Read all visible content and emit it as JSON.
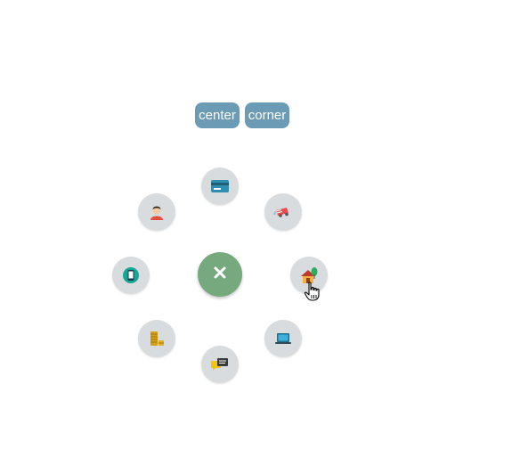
{
  "modes": {
    "center_label": "center",
    "corner_label": "corner"
  },
  "colors": {
    "mode_button": "#6c9bb6",
    "hub": "#76a97e",
    "item_bg": "#d9dcde"
  },
  "menu": {
    "hub_icon": "close-icon",
    "items": [
      {
        "icon": "credit-card-icon"
      },
      {
        "icon": "delivery-truck-icon"
      },
      {
        "icon": "eco-house-icon"
      },
      {
        "icon": "laptop-icon"
      },
      {
        "icon": "chat-bubbles-icon"
      },
      {
        "icon": "coin-stack-icon"
      },
      {
        "icon": "mobile-phone-icon"
      },
      {
        "icon": "user-icon"
      }
    ]
  }
}
